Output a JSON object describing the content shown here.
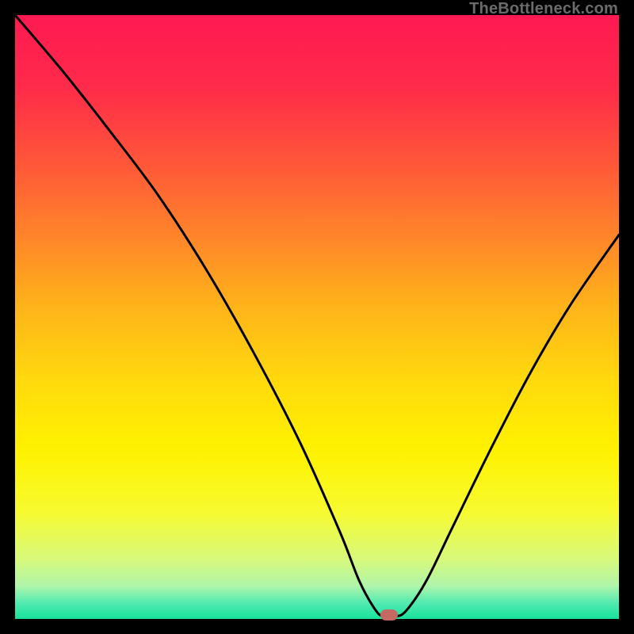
{
  "watermark": {
    "text": "TheBottleneck.com"
  },
  "chart_data": {
    "type": "line",
    "title": "",
    "xlabel": "",
    "ylabel": "",
    "xlim": [
      0,
      100
    ],
    "ylim": [
      0,
      100
    ],
    "background_gradient": {
      "stops": [
        {
          "offset": 0.0,
          "color": "#ff1952"
        },
        {
          "offset": 0.12,
          "color": "#ff2b4a"
        },
        {
          "offset": 0.25,
          "color": "#ff5838"
        },
        {
          "offset": 0.38,
          "color": "#ff8a28"
        },
        {
          "offset": 0.48,
          "color": "#ffb21a"
        },
        {
          "offset": 0.6,
          "color": "#ffd80e"
        },
        {
          "offset": 0.72,
          "color": "#fff200"
        },
        {
          "offset": 0.82,
          "color": "#f7fa2e"
        },
        {
          "offset": 0.9,
          "color": "#d8f97a"
        },
        {
          "offset": 0.945,
          "color": "#b0f5aa"
        },
        {
          "offset": 0.975,
          "color": "#4eeab0"
        },
        {
          "offset": 1.0,
          "color": "#18e29d"
        }
      ]
    },
    "series": [
      {
        "name": "bottleneck-curve",
        "color": "#000000",
        "stroke_width": 3,
        "x": [
          0.0,
          7.9,
          15.7,
          23.6,
          31.5,
          39.4,
          47.2,
          53.8,
          57.0,
          59.6,
          61.0,
          63.0,
          64.8,
          68.1,
          72.4,
          78.7,
          85.3,
          92.1,
          100.0
        ],
        "y": [
          100.0,
          90.7,
          80.8,
          70.3,
          58.1,
          44.3,
          29.2,
          14.4,
          6.3,
          1.6,
          0.4,
          0.4,
          1.4,
          6.3,
          15.1,
          28.0,
          40.7,
          52.2,
          63.6
        ]
      }
    ],
    "marker": {
      "name": "optimal-point",
      "x": 62.0,
      "y": 0.6,
      "color": "#c46a62"
    }
  }
}
